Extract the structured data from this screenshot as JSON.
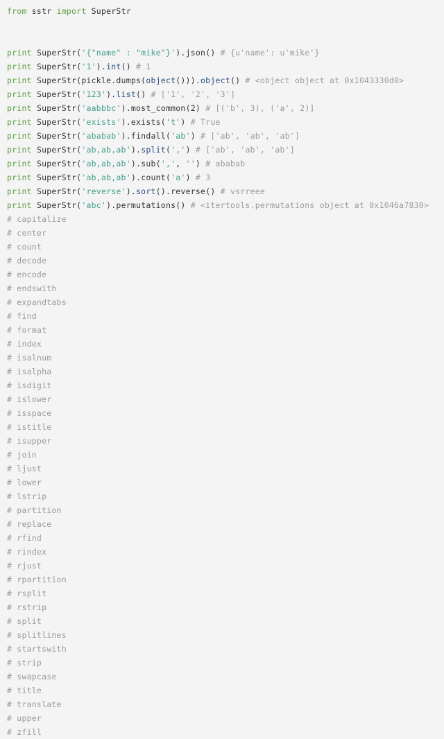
{
  "editor": {
    "background_color": "#f4f4f4",
    "language": "python",
    "colors": {
      "keyword": "#5a9e3f",
      "string": "#3f9e8c",
      "comment": "#9a9a9a",
      "builtin": "#2b4f81",
      "name": "#333333"
    }
  },
  "lines": [
    {
      "id": 1,
      "text": "from sstr import SuperStr",
      "tokens": [
        {
          "t": "from",
          "k": "keyword"
        },
        {
          "t": " ",
          "k": "punct"
        },
        {
          "t": "sstr",
          "k": "name"
        },
        {
          "t": " ",
          "k": "punct"
        },
        {
          "t": "import",
          "k": "keyword"
        },
        {
          "t": " ",
          "k": "punct"
        },
        {
          "t": "SuperStr",
          "k": "name"
        }
      ]
    },
    {
      "id": 2,
      "text": "",
      "tokens": []
    },
    {
      "id": 3,
      "text": "",
      "tokens": []
    },
    {
      "id": 4,
      "text": "print SuperStr('{\"name\" : \"mike\"}').json() # {u'name': u'mike'}",
      "tokens": [
        {
          "t": "print",
          "k": "keyword"
        },
        {
          "t": " ",
          "k": "punct"
        },
        {
          "t": "SuperStr(",
          "k": "name"
        },
        {
          "t": "'{\"name\" : \"mike\"}'",
          "k": "string"
        },
        {
          "t": ").",
          "k": "punct"
        },
        {
          "t": "json",
          "k": "name"
        },
        {
          "t": "() ",
          "k": "punct"
        },
        {
          "t": "# {u'name': u'mike'}",
          "k": "comment"
        }
      ]
    },
    {
      "id": 5,
      "text": "print SuperStr('1').int() # 1",
      "tokens": [
        {
          "t": "print",
          "k": "keyword"
        },
        {
          "t": " ",
          "k": "punct"
        },
        {
          "t": "SuperStr(",
          "k": "name"
        },
        {
          "t": "'1'",
          "k": "string"
        },
        {
          "t": ").",
          "k": "punct"
        },
        {
          "t": "int",
          "k": "builtin"
        },
        {
          "t": "() ",
          "k": "punct"
        },
        {
          "t": "# 1",
          "k": "comment"
        }
      ]
    },
    {
      "id": 6,
      "text": "print SuperStr(pickle.dumps(object())).object() # <object object at 0x1043330d0>",
      "tokens": [
        {
          "t": "print",
          "k": "keyword"
        },
        {
          "t": " ",
          "k": "punct"
        },
        {
          "t": "SuperStr(pickle.dumps(",
          "k": "name"
        },
        {
          "t": "object",
          "k": "builtin"
        },
        {
          "t": "())).",
          "k": "punct"
        },
        {
          "t": "object",
          "k": "builtin"
        },
        {
          "t": "() ",
          "k": "punct"
        },
        {
          "t": "# <object object at 0x1043330d0>",
          "k": "comment"
        }
      ]
    },
    {
      "id": 7,
      "text": "print SuperStr('123').list() # ['1', '2', '3']",
      "tokens": [
        {
          "t": "print",
          "k": "keyword"
        },
        {
          "t": " ",
          "k": "punct"
        },
        {
          "t": "SuperStr(",
          "k": "name"
        },
        {
          "t": "'123'",
          "k": "string"
        },
        {
          "t": ").",
          "k": "punct"
        },
        {
          "t": "list",
          "k": "builtin"
        },
        {
          "t": "() ",
          "k": "punct"
        },
        {
          "t": "# ['1', '2', '3']",
          "k": "comment"
        }
      ]
    },
    {
      "id": 8,
      "text": "print SuperStr('aabbbc').most_common(2) # [('b', 3), ('a', 2)]",
      "tokens": [
        {
          "t": "print",
          "k": "keyword"
        },
        {
          "t": " ",
          "k": "punct"
        },
        {
          "t": "SuperStr(",
          "k": "name"
        },
        {
          "t": "'aabbbc'",
          "k": "string"
        },
        {
          "t": ").",
          "k": "punct"
        },
        {
          "t": "most_common",
          "k": "name"
        },
        {
          "t": "(",
          "k": "punct"
        },
        {
          "t": "2",
          "k": "number"
        },
        {
          "t": ") ",
          "k": "punct"
        },
        {
          "t": "# [('b', 3), ('a', 2)]",
          "k": "comment"
        }
      ]
    },
    {
      "id": 9,
      "text": "print SuperStr('exists').exists('t') # True",
      "tokens": [
        {
          "t": "print",
          "k": "keyword"
        },
        {
          "t": " ",
          "k": "punct"
        },
        {
          "t": "SuperStr(",
          "k": "name"
        },
        {
          "t": "'exists'",
          "k": "string"
        },
        {
          "t": ").",
          "k": "punct"
        },
        {
          "t": "exists",
          "k": "name"
        },
        {
          "t": "(",
          "k": "punct"
        },
        {
          "t": "'t'",
          "k": "string"
        },
        {
          "t": ") ",
          "k": "punct"
        },
        {
          "t": "# True",
          "k": "comment"
        }
      ]
    },
    {
      "id": 10,
      "text": "print SuperStr('ababab').findall('ab') # ['ab', 'ab', 'ab']",
      "tokens": [
        {
          "t": "print",
          "k": "keyword"
        },
        {
          "t": " ",
          "k": "punct"
        },
        {
          "t": "SuperStr(",
          "k": "name"
        },
        {
          "t": "'ababab'",
          "k": "string"
        },
        {
          "t": ").",
          "k": "punct"
        },
        {
          "t": "findall",
          "k": "name"
        },
        {
          "t": "(",
          "k": "punct"
        },
        {
          "t": "'ab'",
          "k": "string"
        },
        {
          "t": ") ",
          "k": "punct"
        },
        {
          "t": "# ['ab', 'ab', 'ab']",
          "k": "comment"
        }
      ]
    },
    {
      "id": 11,
      "text": "print SuperStr('ab,ab,ab').split(',') # ['ab', 'ab', 'ab']",
      "tokens": [
        {
          "t": "print",
          "k": "keyword"
        },
        {
          "t": " ",
          "k": "punct"
        },
        {
          "t": "SuperStr(",
          "k": "name"
        },
        {
          "t": "'ab,ab,ab'",
          "k": "string"
        },
        {
          "t": ").",
          "k": "punct"
        },
        {
          "t": "split",
          "k": "builtin"
        },
        {
          "t": "(",
          "k": "punct"
        },
        {
          "t": "','",
          "k": "string"
        },
        {
          "t": ") ",
          "k": "punct"
        },
        {
          "t": "# ['ab', 'ab', 'ab']",
          "k": "comment"
        }
      ]
    },
    {
      "id": 12,
      "text": "print SuperStr('ab,ab,ab').sub(',', '') # ababab",
      "tokens": [
        {
          "t": "print",
          "k": "keyword"
        },
        {
          "t": " ",
          "k": "punct"
        },
        {
          "t": "SuperStr(",
          "k": "name"
        },
        {
          "t": "'ab,ab,ab'",
          "k": "string"
        },
        {
          "t": ").",
          "k": "punct"
        },
        {
          "t": "sub",
          "k": "name"
        },
        {
          "t": "(",
          "k": "punct"
        },
        {
          "t": "','",
          "k": "string"
        },
        {
          "t": ", ",
          "k": "punct"
        },
        {
          "t": "''",
          "k": "string"
        },
        {
          "t": ") ",
          "k": "punct"
        },
        {
          "t": "# ababab",
          "k": "comment"
        }
      ]
    },
    {
      "id": 13,
      "text": "print SuperStr('ab,ab,ab').count('a') # 3",
      "tokens": [
        {
          "t": "print",
          "k": "keyword"
        },
        {
          "t": " ",
          "k": "punct"
        },
        {
          "t": "SuperStr(",
          "k": "name"
        },
        {
          "t": "'ab,ab,ab'",
          "k": "string"
        },
        {
          "t": ").",
          "k": "punct"
        },
        {
          "t": "count",
          "k": "name"
        },
        {
          "t": "(",
          "k": "punct"
        },
        {
          "t": "'a'",
          "k": "string"
        },
        {
          "t": ") ",
          "k": "punct"
        },
        {
          "t": "# 3",
          "k": "comment"
        }
      ]
    },
    {
      "id": 14,
      "text": "print SuperStr('reverse').sort().reverse() # vsrreee",
      "tokens": [
        {
          "t": "print",
          "k": "keyword"
        },
        {
          "t": " ",
          "k": "punct"
        },
        {
          "t": "SuperStr(",
          "k": "name"
        },
        {
          "t": "'reverse'",
          "k": "string"
        },
        {
          "t": ").",
          "k": "punct"
        },
        {
          "t": "sort",
          "k": "builtin"
        },
        {
          "t": "().",
          "k": "punct"
        },
        {
          "t": "reverse",
          "k": "name"
        },
        {
          "t": "() ",
          "k": "punct"
        },
        {
          "t": "# vsrreee",
          "k": "comment"
        }
      ]
    },
    {
      "id": 15,
      "text": "print SuperStr('abc').permutations() # <itertools.permutations object at 0x1046a7830>",
      "tokens": [
        {
          "t": "print",
          "k": "keyword"
        },
        {
          "t": " ",
          "k": "punct"
        },
        {
          "t": "SuperStr(",
          "k": "name"
        },
        {
          "t": "'abc'",
          "k": "string"
        },
        {
          "t": ").",
          "k": "punct"
        },
        {
          "t": "permutations",
          "k": "name"
        },
        {
          "t": "() ",
          "k": "punct"
        },
        {
          "t": "# <itertools.permutations object at 0x1046a7830>",
          "k": "comment"
        }
      ]
    },
    {
      "id": 16,
      "text": "# capitalize",
      "tokens": [
        {
          "t": "# capitalize",
          "k": "comment"
        }
      ]
    },
    {
      "id": 17,
      "text": "# center",
      "tokens": [
        {
          "t": "# center",
          "k": "comment"
        }
      ]
    },
    {
      "id": 18,
      "text": "# count",
      "tokens": [
        {
          "t": "# count",
          "k": "comment"
        }
      ]
    },
    {
      "id": 19,
      "text": "# decode",
      "tokens": [
        {
          "t": "# decode",
          "k": "comment"
        }
      ]
    },
    {
      "id": 20,
      "text": "# encode",
      "tokens": [
        {
          "t": "# encode",
          "k": "comment"
        }
      ]
    },
    {
      "id": 21,
      "text": "# endswith",
      "tokens": [
        {
          "t": "# endswith",
          "k": "comment"
        }
      ]
    },
    {
      "id": 22,
      "text": "# expandtabs",
      "tokens": [
        {
          "t": "# expandtabs",
          "k": "comment"
        }
      ]
    },
    {
      "id": 23,
      "text": "# find",
      "tokens": [
        {
          "t": "# find",
          "k": "comment"
        }
      ]
    },
    {
      "id": 24,
      "text": "# format",
      "tokens": [
        {
          "t": "# format",
          "k": "comment"
        }
      ]
    },
    {
      "id": 25,
      "text": "# index",
      "tokens": [
        {
          "t": "# index",
          "k": "comment"
        }
      ]
    },
    {
      "id": 26,
      "text": "# isalnum",
      "tokens": [
        {
          "t": "# isalnum",
          "k": "comment"
        }
      ]
    },
    {
      "id": 27,
      "text": "# isalpha",
      "tokens": [
        {
          "t": "# isalpha",
          "k": "comment"
        }
      ]
    },
    {
      "id": 28,
      "text": "# isdigit",
      "tokens": [
        {
          "t": "# isdigit",
          "k": "comment"
        }
      ]
    },
    {
      "id": 29,
      "text": "# islower",
      "tokens": [
        {
          "t": "# islower",
          "k": "comment"
        }
      ]
    },
    {
      "id": 30,
      "text": "# isspace",
      "tokens": [
        {
          "t": "# isspace",
          "k": "comment"
        }
      ]
    },
    {
      "id": 31,
      "text": "# istitle",
      "tokens": [
        {
          "t": "# istitle",
          "k": "comment"
        }
      ]
    },
    {
      "id": 32,
      "text": "# isupper",
      "tokens": [
        {
          "t": "# isupper",
          "k": "comment"
        }
      ]
    },
    {
      "id": 33,
      "text": "# join",
      "tokens": [
        {
          "t": "# join",
          "k": "comment"
        }
      ]
    },
    {
      "id": 34,
      "text": "# ljust",
      "tokens": [
        {
          "t": "# ljust",
          "k": "comment"
        }
      ]
    },
    {
      "id": 35,
      "text": "# lower",
      "tokens": [
        {
          "t": "# lower",
          "k": "comment"
        }
      ]
    },
    {
      "id": 36,
      "text": "# lstrip",
      "tokens": [
        {
          "t": "# lstrip",
          "k": "comment"
        }
      ]
    },
    {
      "id": 37,
      "text": "# partition",
      "tokens": [
        {
          "t": "# partition",
          "k": "comment"
        }
      ]
    },
    {
      "id": 38,
      "text": "# replace",
      "tokens": [
        {
          "t": "# replace",
          "k": "comment"
        }
      ]
    },
    {
      "id": 39,
      "text": "# rfind",
      "tokens": [
        {
          "t": "# rfind",
          "k": "comment"
        }
      ]
    },
    {
      "id": 40,
      "text": "# rindex",
      "tokens": [
        {
          "t": "# rindex",
          "k": "comment"
        }
      ]
    },
    {
      "id": 41,
      "text": "# rjust",
      "tokens": [
        {
          "t": "# rjust",
          "k": "comment"
        }
      ]
    },
    {
      "id": 42,
      "text": "# rpartition",
      "tokens": [
        {
          "t": "# rpartition",
          "k": "comment"
        }
      ]
    },
    {
      "id": 43,
      "text": "# rsplit",
      "tokens": [
        {
          "t": "# rsplit",
          "k": "comment"
        }
      ]
    },
    {
      "id": 44,
      "text": "# rstrip",
      "tokens": [
        {
          "t": "# rstrip",
          "k": "comment"
        }
      ]
    },
    {
      "id": 45,
      "text": "# split",
      "tokens": [
        {
          "t": "# split",
          "k": "comment"
        }
      ]
    },
    {
      "id": 46,
      "text": "# splitlines",
      "tokens": [
        {
          "t": "# splitlines",
          "k": "comment"
        }
      ]
    },
    {
      "id": 47,
      "text": "# startswith",
      "tokens": [
        {
          "t": "# startswith",
          "k": "comment"
        }
      ]
    },
    {
      "id": 48,
      "text": "# strip",
      "tokens": [
        {
          "t": "# strip",
          "k": "comment"
        }
      ]
    },
    {
      "id": 49,
      "text": "# swapcase",
      "tokens": [
        {
          "t": "# swapcase",
          "k": "comment"
        }
      ]
    },
    {
      "id": 50,
      "text": "# title",
      "tokens": [
        {
          "t": "# title",
          "k": "comment"
        }
      ]
    },
    {
      "id": 51,
      "text": "# translate",
      "tokens": [
        {
          "t": "# translate",
          "k": "comment"
        }
      ]
    },
    {
      "id": 52,
      "text": "# upper",
      "tokens": [
        {
          "t": "# upper",
          "k": "comment"
        }
      ]
    },
    {
      "id": 53,
      "text": "# zfill",
      "tokens": [
        {
          "t": "# zfill",
          "k": "comment"
        }
      ]
    }
  ]
}
